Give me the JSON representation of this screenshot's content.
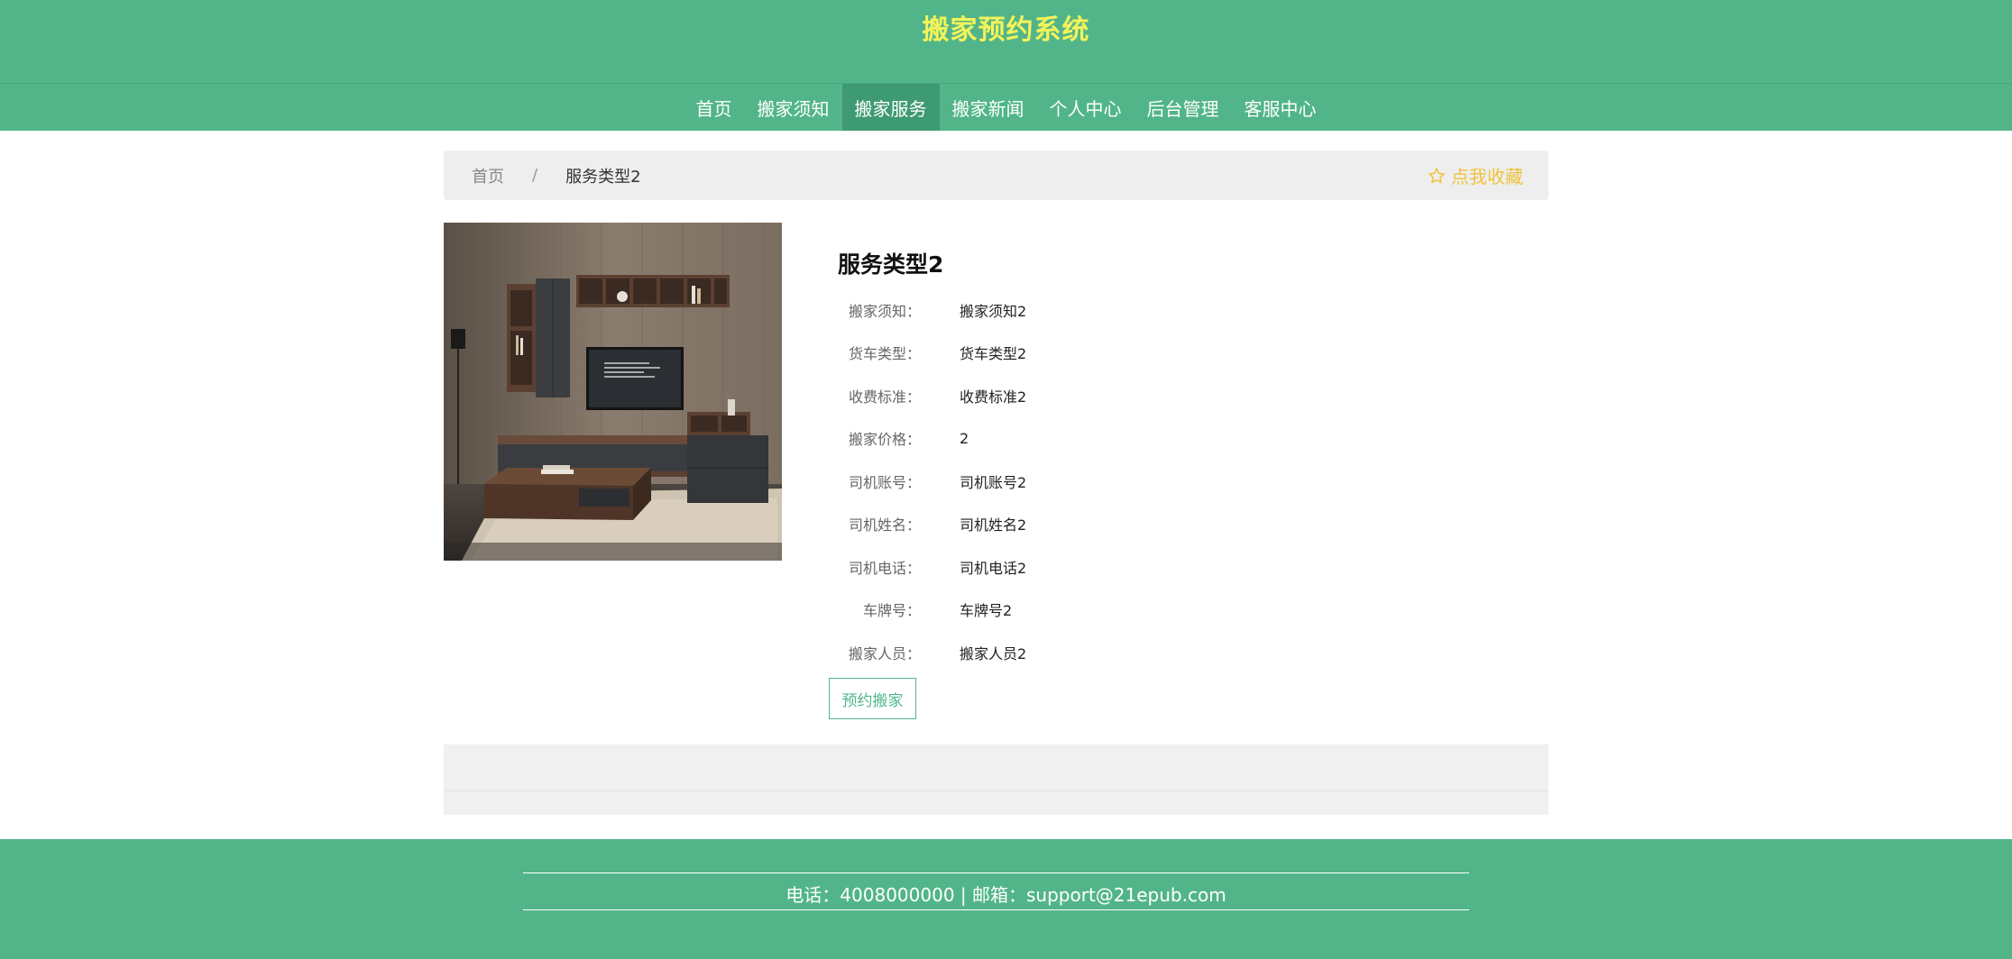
{
  "header": {
    "title": "搬家预约系统"
  },
  "nav": {
    "items": [
      {
        "label": "首页",
        "active": false
      },
      {
        "label": "搬家须知",
        "active": false
      },
      {
        "label": "搬家服务",
        "active": true
      },
      {
        "label": "搬家新闻",
        "active": false
      },
      {
        "label": "个人中心",
        "active": false
      },
      {
        "label": "后台管理",
        "active": false
      },
      {
        "label": "客服中心",
        "active": false
      }
    ]
  },
  "breadcrumb": {
    "home": "首页",
    "separator": "/",
    "current": "服务类型2"
  },
  "favorite": {
    "label": "点我收藏",
    "icon": "star-icon"
  },
  "detail": {
    "title": "服务类型2",
    "fields": [
      {
        "label": "搬家须知：",
        "value": "搬家须知2"
      },
      {
        "label": "货车类型：",
        "value": "货车类型2"
      },
      {
        "label": "收费标准：",
        "value": "收费标准2"
      },
      {
        "label": "搬家价格：",
        "value": "2"
      },
      {
        "label": "司机账号：",
        "value": "司机账号2"
      },
      {
        "label": "司机姓名：",
        "value": "司机姓名2"
      },
      {
        "label": "司机电话：",
        "value": "司机电话2"
      },
      {
        "label": "车牌号：",
        "value": "车牌号2"
      },
      {
        "label": "搬家人员：",
        "value": "搬家人员2"
      }
    ],
    "book_button": "预约搬家"
  },
  "footer": {
    "contact": "电话：4008000000 | 邮箱：support@21epub.com"
  },
  "colors": {
    "brand": "#52b589",
    "title": "#f3f35a",
    "favorite": "#f0c23c"
  }
}
